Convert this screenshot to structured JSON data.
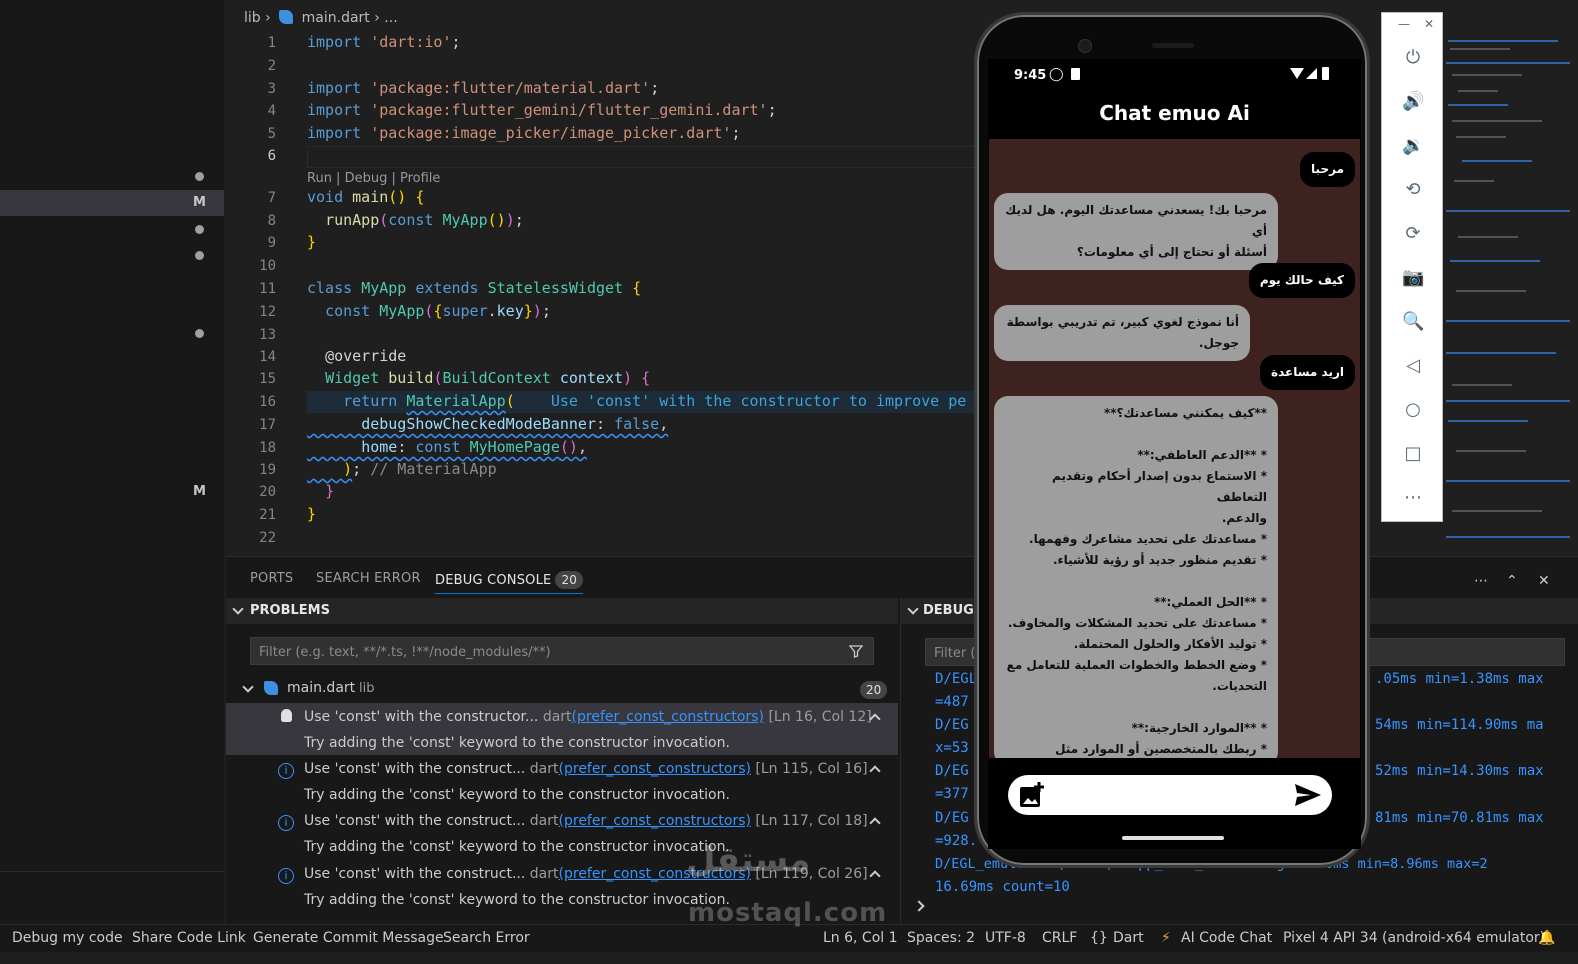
{
  "breadcrumb": {
    "folder": "lib",
    "file": "main.dart",
    "rest": "..."
  },
  "editor": {
    "lines": [
      {
        "n": "1"
      },
      {
        "n": "2"
      },
      {
        "n": "3"
      },
      {
        "n": "4"
      },
      {
        "n": "5"
      },
      {
        "n": "6"
      },
      {
        "n": "7"
      },
      {
        "n": "8"
      },
      {
        "n": "9"
      },
      {
        "n": "10"
      },
      {
        "n": "11"
      },
      {
        "n": "12"
      },
      {
        "n": "13"
      },
      {
        "n": "14"
      },
      {
        "n": "15"
      },
      {
        "n": "16"
      },
      {
        "n": "17"
      },
      {
        "n": "18"
      },
      {
        "n": "19"
      },
      {
        "n": "20"
      },
      {
        "n": "21"
      },
      {
        "n": "22"
      }
    ],
    "codelens": "Run | Debug | Profile",
    "code": {
      "l1_kw": "import",
      "l1_str": "'dart:io'",
      "l3_kw": "import",
      "l3_str": "'package:flutter/material.dart'",
      "l4_kw": "import",
      "l4_str": "'package:flutter_gemini/flutter_gemini.dart'",
      "l5_kw": "import",
      "l5_str": "'package:image_picker/image_picker.dart'",
      "l7_kw": "void",
      "l7_fn": "main",
      "l8_fn": "runApp",
      "l8_kw": "const",
      "l8_ty": "MyApp",
      "l11_kw": "class",
      "l11_ty": "MyApp",
      "l11_kw2": "extends",
      "l11_ty2": "StatelessWidget",
      "l12_kw": "const",
      "l12_ty": "MyApp",
      "l12_kw2": "super",
      "l12_pr": "key",
      "l14_ann": "@override",
      "l15_ty": "Widget",
      "l15_fn": "build",
      "l15_ty2": "BuildContext",
      "l15_pr": "context",
      "l16_kw": "return",
      "l16_ty": "MaterialApp",
      "l16_hint": "Use 'const' with the constructor to improve pe",
      "l17_pr": "debugShowCheckedModeBanner",
      "l17_kw": "false",
      "l18_pr": "home",
      "l18_kw": "const",
      "l18_ty": "MyHomePage",
      "l19_cm": "// MaterialApp"
    }
  },
  "panel": {
    "tabs": [
      {
        "label": "PORTS"
      },
      {
        "label": "SEARCH ERROR"
      },
      {
        "label": "DEBUG CONSOLE",
        "badge": "20"
      }
    ],
    "problems_title": "PROBLEMS",
    "filter_placeholder": "Filter (e.g. text, **/*.ts, !**/node_modules/**)",
    "file": {
      "name": "main.dart",
      "folder": "lib",
      "count": "20"
    },
    "problems": [
      {
        "msg": "Use 'const' with the constructor...",
        "src": "dart",
        "rule": "(prefer_const_constructors)",
        "loc": "[Ln 16, Col 12]",
        "detail": "Try adding the 'const' keyword to the constructor invocation."
      },
      {
        "msg": "Use 'const' with the construct...",
        "src": "dart",
        "rule": "(prefer_const_constructors)",
        "loc": "[Ln 115, Col 16]",
        "detail": "Try adding the 'const' keyword to the constructor invocation."
      },
      {
        "msg": "Use 'const' with the construct...",
        "src": "dart",
        "rule": "(prefer_const_constructors)",
        "loc": "[Ln 117, Col 18]",
        "detail": "Try adding the 'const' keyword to the constructor invocation."
      },
      {
        "msg": "Use 'const' with the construct...",
        "src": "dart",
        "rule": "(prefer_const_constructors)",
        "loc": "[Ln 119, Col 26]",
        "detail": "Try adding the 'const' keyword to the constructor invocation."
      }
    ],
    "debug_title": "DEBUG",
    "debug_filter": "Filter (",
    "debug_lines": [
      {
        "left": "D/EGL",
        "right": ".05ms min=1.38ms max"
      },
      {
        "left": "=487",
        "right": ""
      },
      {
        "left": "D/EG",
        "right": "54ms min=114.90ms ma"
      },
      {
        "left": "x=53",
        "right": ""
      },
      {
        "left": "D/EG",
        "right": "52ms min=14.30ms max"
      },
      {
        "left": "=377",
        "right": ""
      },
      {
        "left": "D/EG",
        "right": "81ms min=70.81ms max"
      },
      {
        "left": "=928.",
        "right": ""
      },
      {
        "left": "D/EGL_emulation(24599): app_time_stats: avg=85.70ms min=8.96ms max=2",
        "right": ""
      },
      {
        "left": "16.69ms count=10",
        "right": ""
      }
    ]
  },
  "statusbar": {
    "left": [
      "Debug my code",
      "Share Code Link",
      "Generate Commit Message",
      "Search Error"
    ],
    "pos": "Ln 6, Col 1",
    "spaces": "Spaces: 2",
    "enc": "UTF-8",
    "eol": "CRLF",
    "lang": "Dart",
    "ai": "AI Code Chat",
    "device": "Pixel 4 API 34 (android-x64 emulator)"
  },
  "sidebar": {
    "markers": [
      "M",
      "M"
    ]
  },
  "phone": {
    "time": "9:45",
    "title": "Chat emuo Ai",
    "messages": [
      {
        "role": "user",
        "text": "مرحبا"
      },
      {
        "role": "bot",
        "text": "مرحبا بك! يسعدني مساعدتك اليوم. هل لديك أي\nأسئلة أو تحتاج إلى أي معلومات؟"
      },
      {
        "role": "user",
        "text": "كيف حالك يوم"
      },
      {
        "role": "bot",
        "text": "أنا نموذج لغوي كبير، تم تدريبي بواسطة جوجل."
      },
      {
        "role": "user",
        "text": "اريد مساعدة"
      },
      {
        "role": "bot",
        "text": "**كيف يمكنني مساعدتك؟**\n\n* **الدعم العاطفي:**\n   * الاستماع بدون إصدار أحكام وتقديم التعاطف\nوالدعم.\n   * مساعدتك على تحديد مشاعرك وفهمها.\n   * تقديم منظور جديد أو رؤية للأشياء.\n\n* **الحل العملي:**\n   * مساعدتك على تحديد المشكلات والمخاوف.\n   * توليد الأفكار والحلول المحتملة.\n   * وضع الخطط والخطوات العملية للتعامل مع\nالتحديات.\n\n* **الموارد الخارجية:**\n   * ربطك بالمتخصصين أو الموارد مثل المعالجين أو\nمجموعات الدعم."
      }
    ]
  },
  "watermark": {
    "ar": "مستقل",
    "en": "mostaql.com"
  },
  "colors": {
    "accent": "#0078d4",
    "chat_bg": "#3d2220",
    "bot_bubble": "#9e9e9e",
    "link": "#3794ff"
  }
}
